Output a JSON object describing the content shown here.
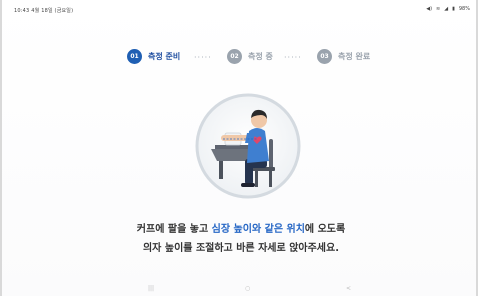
{
  "status": {
    "time": "10:43",
    "date": "4월 18일 (금요일)",
    "right_icons": [
      "volume-icon",
      "wifi-icon",
      "signal-icon",
      "battery-icon"
    ],
    "battery": "98%"
  },
  "stepper": {
    "steps": [
      {
        "num": "01",
        "label": "측정 준비",
        "active": true
      },
      {
        "num": "02",
        "label": "측정 중",
        "active": false
      },
      {
        "num": "03",
        "label": "측정 완료",
        "active": false
      }
    ],
    "dots": "·····"
  },
  "instruction": {
    "line1_pre": "커프에 팔을 놓고 ",
    "line1_hl": "심장 높이와 같은 위치",
    "line1_post": "에 오도록",
    "line2": "의자 높이를 조절하고 바른 자세로 앉아주세요."
  },
  "colors": {
    "accent": "#1f5fb3",
    "inactive": "#9aa3ad",
    "highlight": "#2566c5"
  },
  "navbar": {
    "icons": [
      "recent-apps-icon",
      "home-icon",
      "back-icon"
    ]
  }
}
